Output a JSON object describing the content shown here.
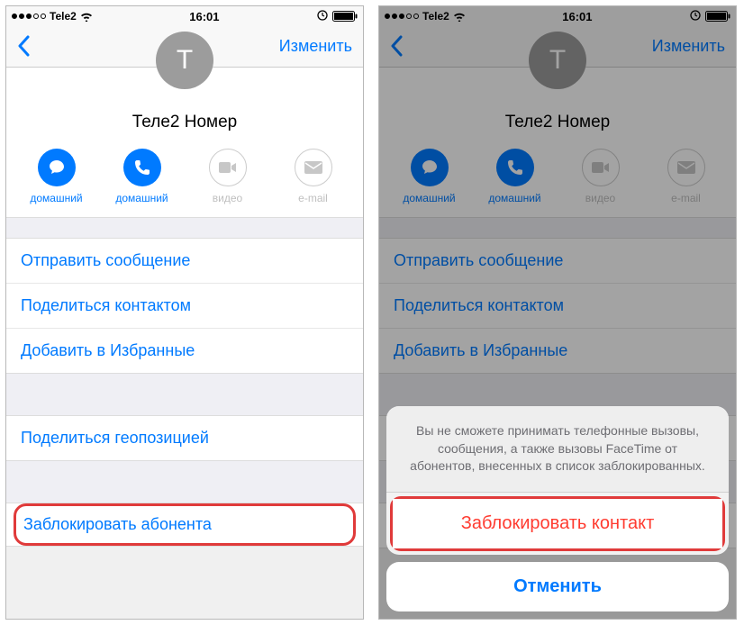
{
  "status": {
    "carrier": "Tele2",
    "time": "16:01",
    "wifi_signal": 3
  },
  "nav": {
    "edit": "Изменить"
  },
  "contact": {
    "initial": "Т",
    "name": "Теле2 Номер"
  },
  "quick_actions": [
    {
      "label": "домашний",
      "icon": "message",
      "active": true
    },
    {
      "label": "домашний",
      "icon": "phone",
      "active": true
    },
    {
      "label": "видео",
      "icon": "video",
      "active": false
    },
    {
      "label": "e-mail",
      "icon": "mail",
      "active": false
    }
  ],
  "group1": [
    "Отправить сообщение",
    "Поделиться контактом",
    "Добавить в Избранные"
  ],
  "group2": [
    "Поделиться геопозицией"
  ],
  "block_item": "Заблокировать абонента",
  "sheet": {
    "message": "Вы не сможете принимать телефонные вызовы, сообщения, а также вызовы FaceTime от абонентов, внесенных в список заблокированных.",
    "block": "Заблокировать контакт",
    "cancel": "Отменить"
  }
}
